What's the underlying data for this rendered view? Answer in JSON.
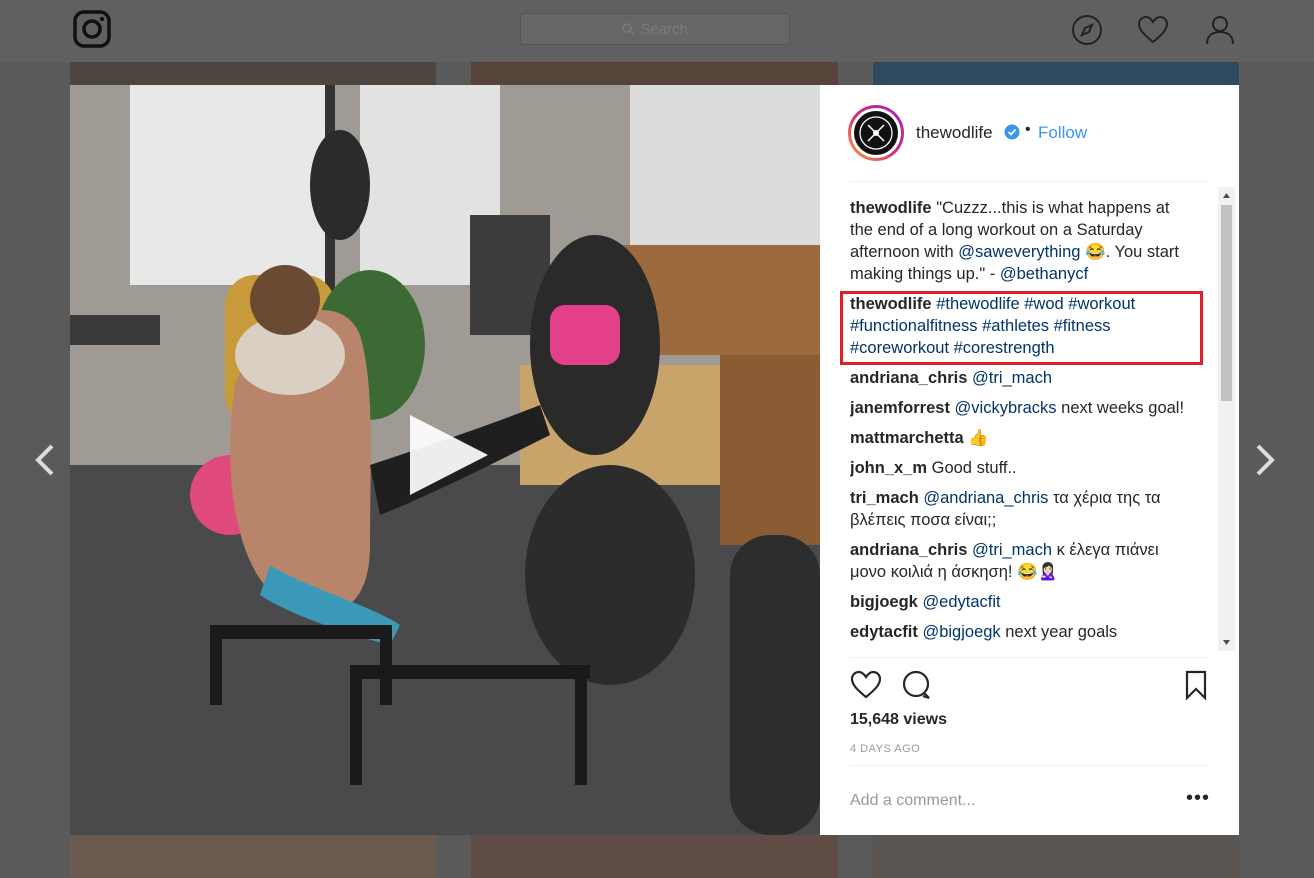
{
  "header": {
    "search_placeholder": "Search",
    "icons": [
      "instagram-logo-icon",
      "search-icon",
      "compass-icon",
      "heart-icon",
      "profile-icon"
    ]
  },
  "post": {
    "username": "thewodlife",
    "separator": "•",
    "follow_label": "Follow",
    "caption": {
      "user": "thewodlife",
      "text_1": "\"Cuzzz...this is what happens at the end of a long workout on a Saturday afternoon with ",
      "mention_1": "@saweverything",
      "text_2": " 😂. You start making things up.\" - ",
      "mention_2": "@bethanycf"
    },
    "hashtag_comment": {
      "user": "thewodlife",
      "tags": "#thewodlife #wod #workout #functionalfitness #athletes #fitness #coreworkout #corestrength"
    },
    "comments": [
      {
        "user": "andriana_chris",
        "mention": "@tri_mach",
        "text": ""
      },
      {
        "user": "janemforrest",
        "mention": "@vickybracks",
        "text": " next weeks goal!"
      },
      {
        "user": "mattmarchetta",
        "mention": "",
        "text": "👍"
      },
      {
        "user": "john_x_m",
        "mention": "",
        "text": "Good stuff.."
      },
      {
        "user": "tri_mach",
        "mention": "@andriana_chris",
        "text": " τα χέρια της τα βλέπεις ποσα είναι;;"
      },
      {
        "user": "andriana_chris",
        "mention": "@tri_mach",
        "text": " κ έλεγα πιάνει μονο κοιλιά η άσκηση! 😂🙎🏻‍♀️"
      },
      {
        "user": "bigjoegk",
        "mention": "@edytacfit",
        "text": ""
      },
      {
        "user": "edytacfit",
        "mention": "@bigjoegk",
        "text": " next year goals"
      }
    ],
    "views": "15,648 views",
    "date": "4 DAYS AGO",
    "comment_placeholder": "Add a comment...",
    "more_label": "•••"
  },
  "colors": {
    "link": "#003569",
    "follow": "#3897f0",
    "highlight": "#e01f2a"
  }
}
